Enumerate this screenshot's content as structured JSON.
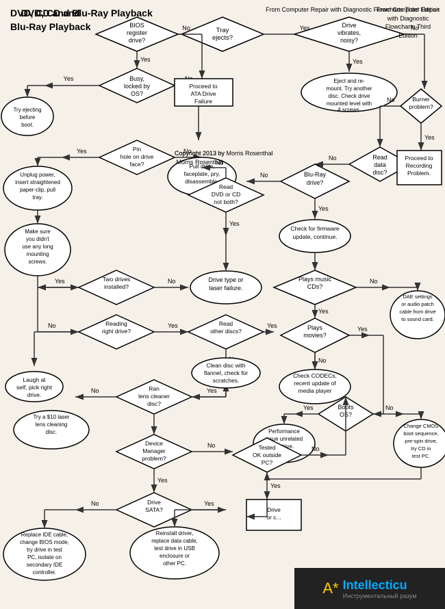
{
  "title": "DVD, CD and\nBlu-Ray Playback",
  "source": "From Computer Repair\nwith Diagnostic\nFlowcharts Third\nEdition",
  "copyright": "Copyright 2013 by\nMorris Rosenthal",
  "nodes": {
    "tray_ejects": "Tray ejects?",
    "bios_register": "BIOS register drive?",
    "drive_vibrates": "Drive vibrates, noisy?",
    "busy_locked": "Busy, locked by OS?",
    "proceed_ata": "Proceed to ATA Drive Failure",
    "eject_remount": "Eject and re-mount. Try another disc. Check drive mounted level with 4 screws.",
    "burner_problem": "Burner problem?",
    "try_ejecting": "Try ejecting before boot.",
    "pin_hole": "Pin hole on drive face?",
    "read_data_disc": "Read data disc?",
    "unplug_power": "Unplug power, insert straightened paper-clip, pull tray.",
    "pull_drive": "Pull drive, faceplate, pry, disassemble.",
    "blu_ray_drive": "Blu-Ray drive?",
    "proceed_recording": "Proceed to Recording Problem.",
    "make_sure": "Make sure you didn't use any long mounting screws.",
    "read_dvd_cd": "Read DVD or CD not both?",
    "firmware": "Check for firmware update, continue.",
    "two_drives": "Two drives installed?",
    "drive_type_laser": "Drive type or laser failure.",
    "plays_music": "Plays music CDs?",
    "reading_right_drive": "Reading right drive?",
    "read_other_discs": "Read other discs?",
    "plays_movies": "Plays movies?",
    "dae_settings": "DAE settings or audio patch cable from drive to sound card.",
    "laugh": "Laugh at self, pick right drive.",
    "ran_lens_cleaner": "Ran lens cleaner disc?",
    "clean_disc": "Clean disc with flannel, check for scratches.",
    "check_codecs": "Check CODECs, recent update of media player",
    "try_laser": "Try a $10 laser lens cleaning disc.",
    "boots_os": "Boots OS?",
    "device_manager": "Device Manager problem?",
    "performance_issue": "Performance issue unrelated to drive.",
    "change_cmos": "Change CMOS boot sequence, pre-spin drive, try CD in test PC.",
    "drive_sata": "Drive SATA?",
    "tested_ok": "Tested OK outside PC?",
    "replace_ide": "Replace IDE cable, change BIOS mode, try drive in test PC, isolate on secondary IDE controller.",
    "reinstall_driver": "Reinstall driver, replace data cable, test drive in USB enclosure or other PC.",
    "drive_or_comp": "Drive or comp..."
  },
  "labels": {
    "yes": "Yes",
    "no": "No"
  }
}
